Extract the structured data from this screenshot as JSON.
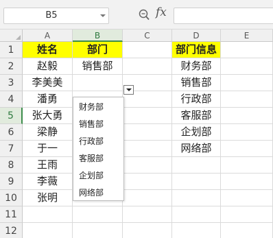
{
  "formula_bar": {
    "name_box": "B5",
    "fx_label": "fx",
    "formula_value": ""
  },
  "columns": [
    "A",
    "B",
    "C",
    "D",
    "E"
  ],
  "rows": [
    "1",
    "2",
    "3",
    "4",
    "5",
    "6",
    "7",
    "8",
    "9",
    "10",
    "11",
    "12"
  ],
  "cells": {
    "A1": "姓名",
    "B1": "部门",
    "D1": "部门信息",
    "A2": "赵毅",
    "B2": "销售部",
    "D2": "财务部",
    "A3": "李美美",
    "D3": "销售部",
    "A4": "潘勇",
    "D4": "行政部",
    "A5": "张大勇",
    "D5": "客服部",
    "A6": "梁静",
    "D6": "企划部",
    "A7": "于一",
    "D7": "网络部",
    "A8": "王雨",
    "A9": "李薇",
    "A10": "张明"
  },
  "active_cell": "B5",
  "header_fill_color": "#ffff00",
  "selection_color": "#2e8b40",
  "dropdown": {
    "options": [
      "财务部",
      "销售部",
      "行政部",
      "客服部",
      "企划部",
      "网络部"
    ]
  }
}
